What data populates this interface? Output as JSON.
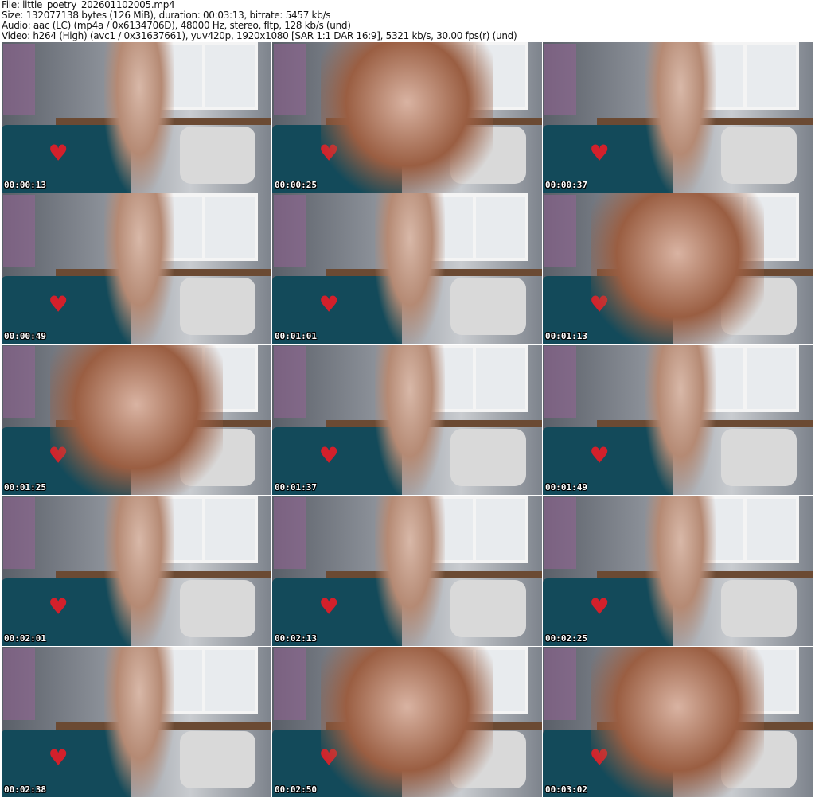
{
  "header": {
    "file": "File: little_poetry_202601102005.mp4",
    "size": "Size: 132077138 bytes (126 MiB), duration: 00:03:13, bitrate: 5457 kb/s",
    "audio": "Audio: aac (LC) (mp4a / 0x6134706D), 48000 Hz, stereo, fltp, 128 kb/s (und)",
    "video": "Video: h264 (High) (avc1 / 0x31637661), yuv420p, 1920x1080 [SAR 1:1 DAR 16:9], 5321 kb/s, 30.00 fps(r) (und)"
  },
  "thumbnails": [
    {
      "time": "00:00:13",
      "close": false
    },
    {
      "time": "00:00:25",
      "close": true
    },
    {
      "time": "00:00:37",
      "close": false
    },
    {
      "time": "00:00:49",
      "close": false
    },
    {
      "time": "00:01:01",
      "close": false
    },
    {
      "time": "00:01:13",
      "close": true
    },
    {
      "time": "00:01:25",
      "close": true
    },
    {
      "time": "00:01:37",
      "close": false
    },
    {
      "time": "00:01:49",
      "close": false
    },
    {
      "time": "00:02:01",
      "close": false
    },
    {
      "time": "00:02:13",
      "close": false
    },
    {
      "time": "00:02:25",
      "close": false
    },
    {
      "time": "00:02:38",
      "close": false
    },
    {
      "time": "00:02:50",
      "close": true
    },
    {
      "time": "00:03:02",
      "close": true
    }
  ]
}
